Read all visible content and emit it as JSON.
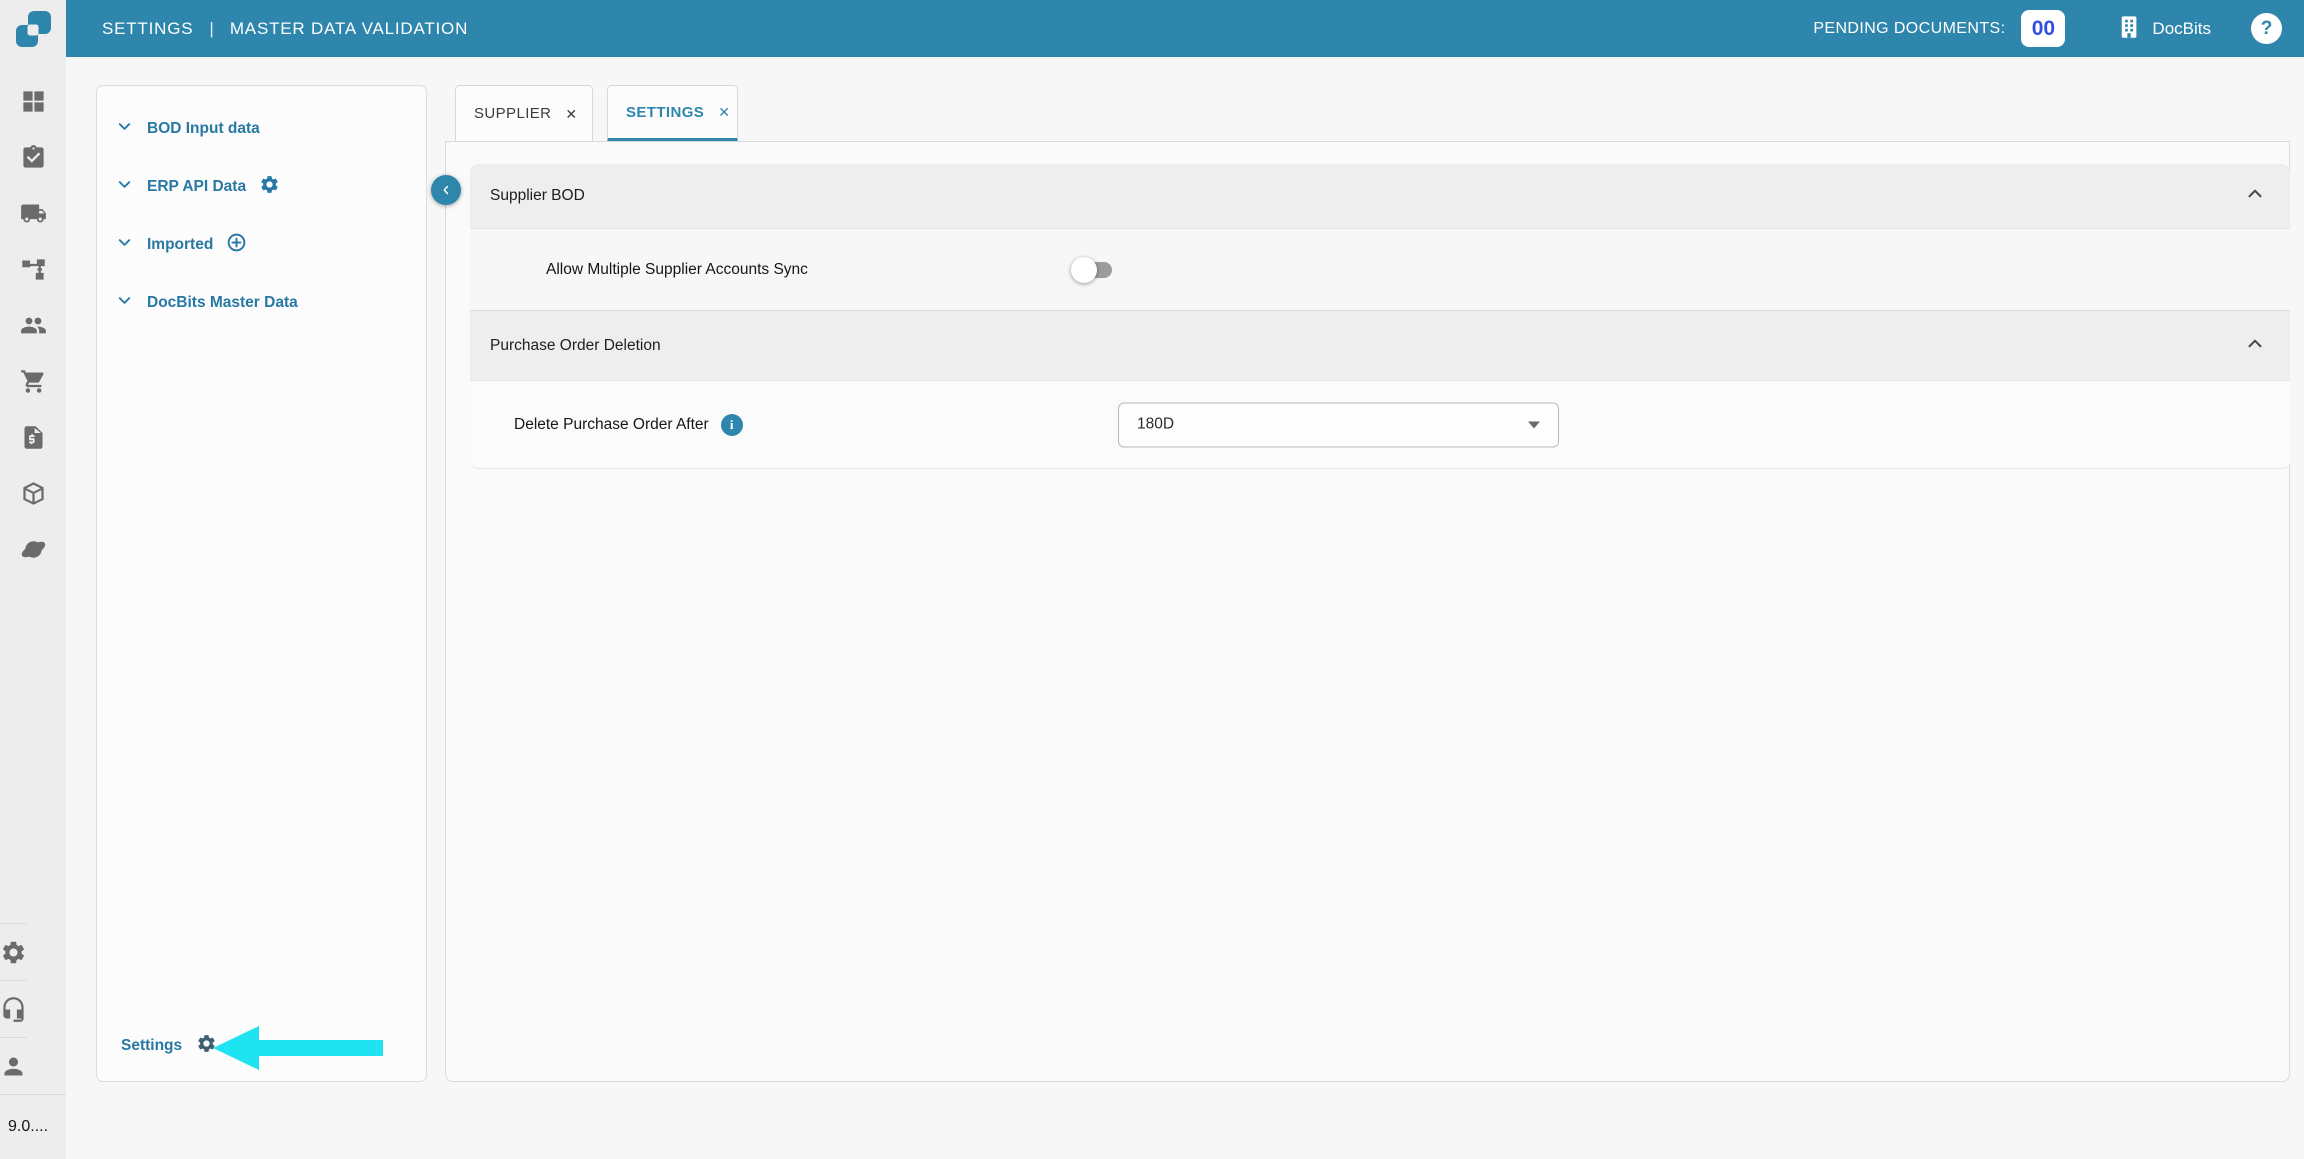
{
  "colors": {
    "header_teal": "#2E86AD",
    "link_teal": "#2878A4",
    "badge_blue": "#3150DF",
    "arrow_cyan": "#1FE3F1",
    "rail_icon_gray": "#6B6B6B"
  },
  "glyphs": {
    "close": "✕",
    "help": "?",
    "info": "i"
  },
  "header": {
    "nav_section": "SETTINGS",
    "divider": "|",
    "nav_page": "MASTER DATA VALIDATION",
    "pending_label": "PENDING DOCUMENTS:",
    "pending_count": "00",
    "org_name": "DocBits"
  },
  "rail": {
    "icons": [
      "dashboard",
      "tasks",
      "shipping",
      "workflow",
      "users",
      "cart",
      "invoice",
      "package",
      "integrations"
    ],
    "bottom_icons": [
      "settings",
      "support",
      "account"
    ],
    "version": "9.0...."
  },
  "sidebar": {
    "items": [
      {
        "label": "BOD Input data",
        "leading_icon": "chevron-down"
      },
      {
        "label": "ERP API Data",
        "leading_icon": "chevron-down",
        "trailing_icon": "gear"
      },
      {
        "label": "Imported",
        "leading_icon": "chevron-down",
        "trailing_icon": "plus-circle"
      },
      {
        "label": "DocBits Master Data",
        "leading_icon": "chevron-down"
      }
    ],
    "settings_label": "Settings"
  },
  "tabs": [
    {
      "label": "SUPPLIER",
      "active": false
    },
    {
      "label": "SETTINGS",
      "active": true
    }
  ],
  "content": {
    "sections": [
      {
        "title": "Supplier BOD",
        "collapse_icon": "chevron-up",
        "rows": [
          {
            "label": "Allow Multiple Supplier Accounts Sync",
            "control": "toggle",
            "value": "off"
          }
        ]
      },
      {
        "title": "Purchase Order Deletion",
        "collapse_icon": "chevron-up",
        "rows": [
          {
            "label": "Delete Purchase Order After",
            "control": "select",
            "value": "180D",
            "info": true
          }
        ]
      }
    ]
  }
}
